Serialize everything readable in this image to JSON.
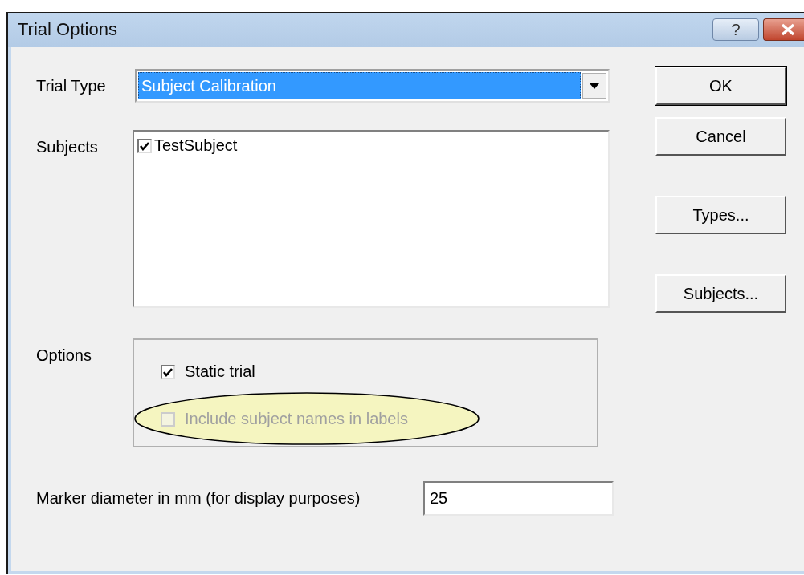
{
  "window": {
    "title": "Trial Options",
    "help_button": "?"
  },
  "trial_type": {
    "label": "Trial Type",
    "value": "Subject Calibration"
  },
  "subjects": {
    "label": "Subjects",
    "items": [
      {
        "label": "TestSubject",
        "checked": true
      }
    ]
  },
  "options": {
    "label": "Options",
    "items": [
      {
        "label": "Static trial",
        "checked": true,
        "disabled": false,
        "highlighted": false
      },
      {
        "label": "Include subject names in labels",
        "checked": false,
        "disabled": true,
        "highlighted": true
      }
    ]
  },
  "marker_diameter": {
    "label": "Marker diameter in mm (for display purposes)",
    "value": "25"
  },
  "buttons": [
    {
      "label": "OK",
      "kind": "default"
    },
    {
      "label": "Cancel",
      "kind": "normal"
    },
    {
      "label": "Types...",
      "kind": "normal"
    },
    {
      "label": "Subjects...",
      "kind": "normal"
    }
  ]
}
